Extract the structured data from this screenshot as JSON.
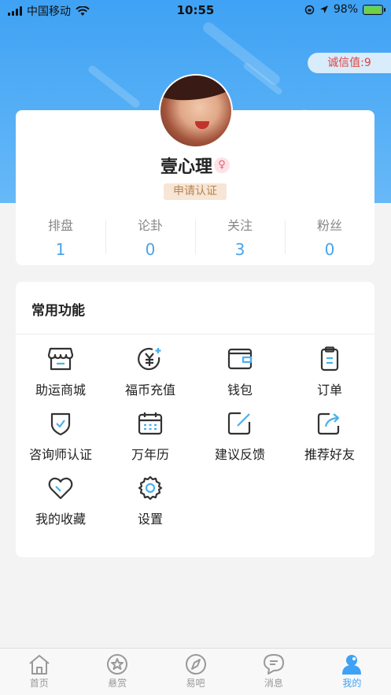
{
  "status_bar": {
    "carrier": "中国移动",
    "time": "10:55",
    "battery_percent": "98%",
    "battery_level": 0.98
  },
  "header": {
    "credit_label": "诚信值:9"
  },
  "profile": {
    "username": "壹心理",
    "gender_symbol": "♀",
    "cert_button": "申请认证",
    "stats": [
      {
        "label": "排盘",
        "value": "1"
      },
      {
        "label": "论卦",
        "value": "0"
      },
      {
        "label": "关注",
        "value": "3"
      },
      {
        "label": "粉丝",
        "value": "0"
      }
    ]
  },
  "functions": {
    "title": "常用功能",
    "items": [
      {
        "label": "助运商城",
        "icon": "shop-icon"
      },
      {
        "label": "福币充值",
        "icon": "coin-recharge-icon"
      },
      {
        "label": "钱包",
        "icon": "wallet-icon"
      },
      {
        "label": "订单",
        "icon": "order-clipboard-icon"
      },
      {
        "label": "咨询师认证",
        "icon": "shield-check-icon"
      },
      {
        "label": "万年历",
        "icon": "calendar-icon"
      },
      {
        "label": "建议反馈",
        "icon": "feedback-edit-icon"
      },
      {
        "label": "推荐好友",
        "icon": "share-icon"
      },
      {
        "label": "我的收藏",
        "icon": "heart-icon"
      },
      {
        "label": "设置",
        "icon": "gear-icon"
      }
    ]
  },
  "tabbar": {
    "tabs": [
      {
        "label": "首页",
        "icon": "home-icon",
        "active": false
      },
      {
        "label": "悬赏",
        "icon": "star-icon",
        "active": false
      },
      {
        "label": "易吧",
        "icon": "compass-icon",
        "active": false
      },
      {
        "label": "消息",
        "icon": "chat-icon",
        "active": false
      },
      {
        "label": "我的",
        "icon": "user-icon",
        "active": true
      }
    ]
  },
  "colors": {
    "accent": "#3fa2f4",
    "stat_value": "#4aa3ea",
    "credit_text": "#e0443e",
    "icon_accent": "#4ab0ec"
  }
}
